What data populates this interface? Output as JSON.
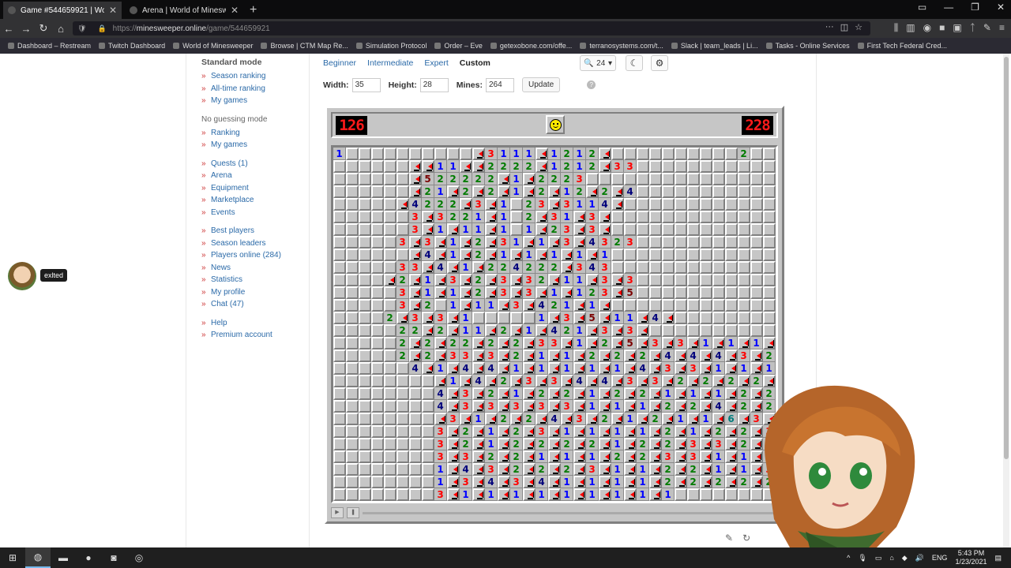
{
  "browser": {
    "tabs": [
      {
        "title": "Game #544659921 | World of M",
        "active": true
      },
      {
        "title": "Arena | World of Minesweeper",
        "active": false
      }
    ],
    "url_prefix": "https://",
    "url_host": "minesweeper.online",
    "url_path": "/game/544659921",
    "bookmarks": [
      "Dashboard – Restream",
      "Twitch Dashboard",
      "World of Minesweeper",
      "Browse | CTM Map Re...",
      "Simulation Protocol",
      "Order – Eve",
      "getexobone.com/offe...",
      "terranosystems.com/t...",
      "Slack | team_leads | Li...",
      "Tasks - Online Services",
      "First Tech Federal Cred..."
    ]
  },
  "sidebar": {
    "title": "Standard mode",
    "group1": [
      "Season ranking",
      "All-time ranking",
      "My games"
    ],
    "ng_title": "No guessing mode",
    "group2": [
      "Ranking",
      "My games"
    ],
    "group3": [
      "Quests (1)",
      "Arena",
      "Equipment",
      "Marketplace",
      "Events"
    ],
    "group4": [
      "Best players",
      "Season leaders",
      "Players online (284)",
      "News",
      "Statistics",
      "My profile",
      "Chat (47)"
    ],
    "group5": [
      "Help",
      "Premium account"
    ]
  },
  "user": {
    "name": "exlted"
  },
  "controls": {
    "modes": [
      "Beginner",
      "Intermediate",
      "Expert",
      "Custom"
    ],
    "active_mode": "Custom",
    "zoom": "24",
    "width_label": "Width:",
    "width": "35",
    "height_label": "Height:",
    "height": "28",
    "mines_label": "Mines:",
    "mines": "264",
    "update_label": "Update"
  },
  "game": {
    "mines_left": "126",
    "timer": "228",
    "cols": 35,
    "rows": 28,
    "board": [
      "1..........F3111F1212F..........2",
      "......FF11FF2222F1212F33..........",
      "......F522222F1F2223........",
      "......F21F2F2F1F2F12F2F4........",
      ".....F4222F3F1.23F3114F........",
      "......3F3221F1.2F31F3F........",
      "......3F1F11F1.1F23F3F........",
      ".....3F3F1F2F31F1F3F4323........",
      "......F4F1F2F1F1F1F1F1........",
      ".....33F4F1F224222F343........",
      "....F2F1F3F2F3F32F11F3F3........",
      ".....3F1F1F2F3F3F1F123F5........",
      ".....3F2.1F11F3F421F1F........",
      "....2F3F3F1.....1F3F5F11F4F........",
      ".....22F2F11F2F1F421F3F3F........",
      ".....2F2F22F2F2F33F1F2F5F3F3F1F1F1F",
      ".....2F2F33F3F2F1F1F2F2F2F4F4F4F3F2F3F3F4",
      "......4F1F4F4F1F1F1F1F1F4F3F3F1F1F1F1F1F2F1",
      "........F1F4F2F3F3F4F4F3F3F2F2F2F2F1F2",
      "........4F3F2F1F2F2F1F2F2F1F1F1F2F2F3F3F3F3",
      "........4F3F3F3F3F3F1F1F1F2F2F4F2F2",
      "........F3F1F2F2F4F3F2F1F2F1F1F6F3F3F2F3",
      "........3F2F1F2F3F1F1F1F1F2F1F2F2F3F3F2F1F1",
      "........3F2F1F2F2F2F2F1F2F2F3F3F2F1F2F2F2",
      "........3F3F2F2F1F1F1F2F2F3F3F1F1F1F3F4F3F2F1F2",
      "........1F4F3F2F2F2F3F1F1F2F2F1F1F3F3F3F1F1",
      "........1F3F4F3F4F1F1F1F1F2F2F2F2F2F2F1",
      "........3F1F1F1F1F1F1F1F1F1"
    ]
  },
  "taskbar": {
    "lang": "ENG",
    "time": "5:43 PM",
    "date": "1/23/2021"
  }
}
